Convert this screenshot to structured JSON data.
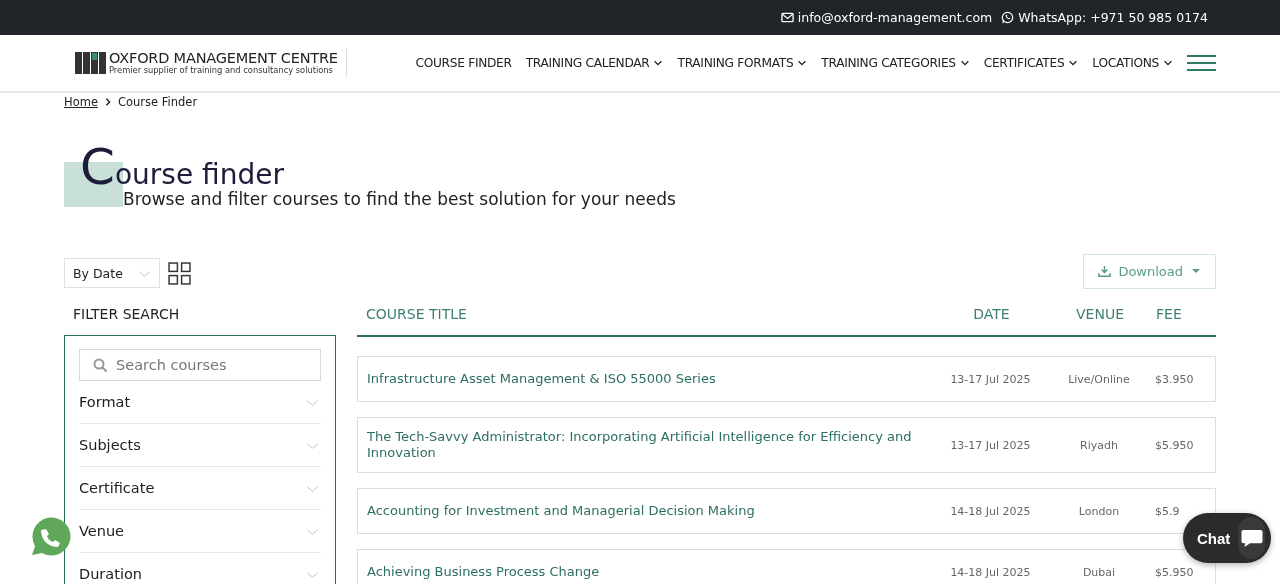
{
  "top_bar": {
    "email": "info@oxford-management.com",
    "whatsapp": "WhatsApp: +971 50 985 0174"
  },
  "header": {
    "logo_name": "OXFORD MANAGEMENT CENTRE",
    "logo_tagline": "Premier supplier of training and consultancy solutions",
    "nav": [
      {
        "label": "COURSE FINDER",
        "dropdown": false
      },
      {
        "label": "TRAINING CALENDAR",
        "dropdown": true
      },
      {
        "label": "TRAINING FORMATS",
        "dropdown": true
      },
      {
        "label": "TRAINING CATEGORIES",
        "dropdown": true
      },
      {
        "label": "CERTIFICATES",
        "dropdown": true
      },
      {
        "label": "LOCATIONS",
        "dropdown": true
      }
    ]
  },
  "breadcrumb": [
    "Home",
    "Course Finder"
  ],
  "page_title": "Course finder",
  "page_subtitle": "Browse and filter courses to find the best solution for your needs",
  "sort": {
    "value": "By Date"
  },
  "download_label": "Download",
  "filter": {
    "heading": "FILTER SEARCH",
    "search": {
      "placeholder": "Search courses"
    },
    "groups": [
      {
        "label": "Format",
        "expanded": false
      },
      {
        "label": "Subjects",
        "expanded": false
      },
      {
        "label": "Certificate",
        "expanded": false
      },
      {
        "label": "Venue",
        "expanded": false
      },
      {
        "label": "Duration",
        "expanded": false
      }
    ]
  },
  "table": {
    "columns": [
      "COURSE TITLE",
      "DATE",
      "VENUE",
      "FEE"
    ],
    "rows": [
      {
        "title": "Infrastructure Asset Management & ISO 55000 Series",
        "date": "13-17 Jul 2025",
        "venue": "Live/Online",
        "fee": "$3.950"
      },
      {
        "title": "The Tech-Savvy Administrator: Incorporating Artificial Intelligence for Efficiency and Innovation",
        "date": "13-17 Jul 2025",
        "venue": "Riyadh",
        "fee": "$5.950"
      },
      {
        "title": "Accounting for Investment and Managerial Decision Making",
        "date": "14-18 Jul 2025",
        "venue": "London",
        "fee": "$5.9"
      },
      {
        "title": "Achieving Business Process Change",
        "date": "14-18 Jul 2025",
        "venue": "Dubai",
        "fee": "$5.950"
      }
    ]
  },
  "chat": {
    "label": "Chat"
  }
}
